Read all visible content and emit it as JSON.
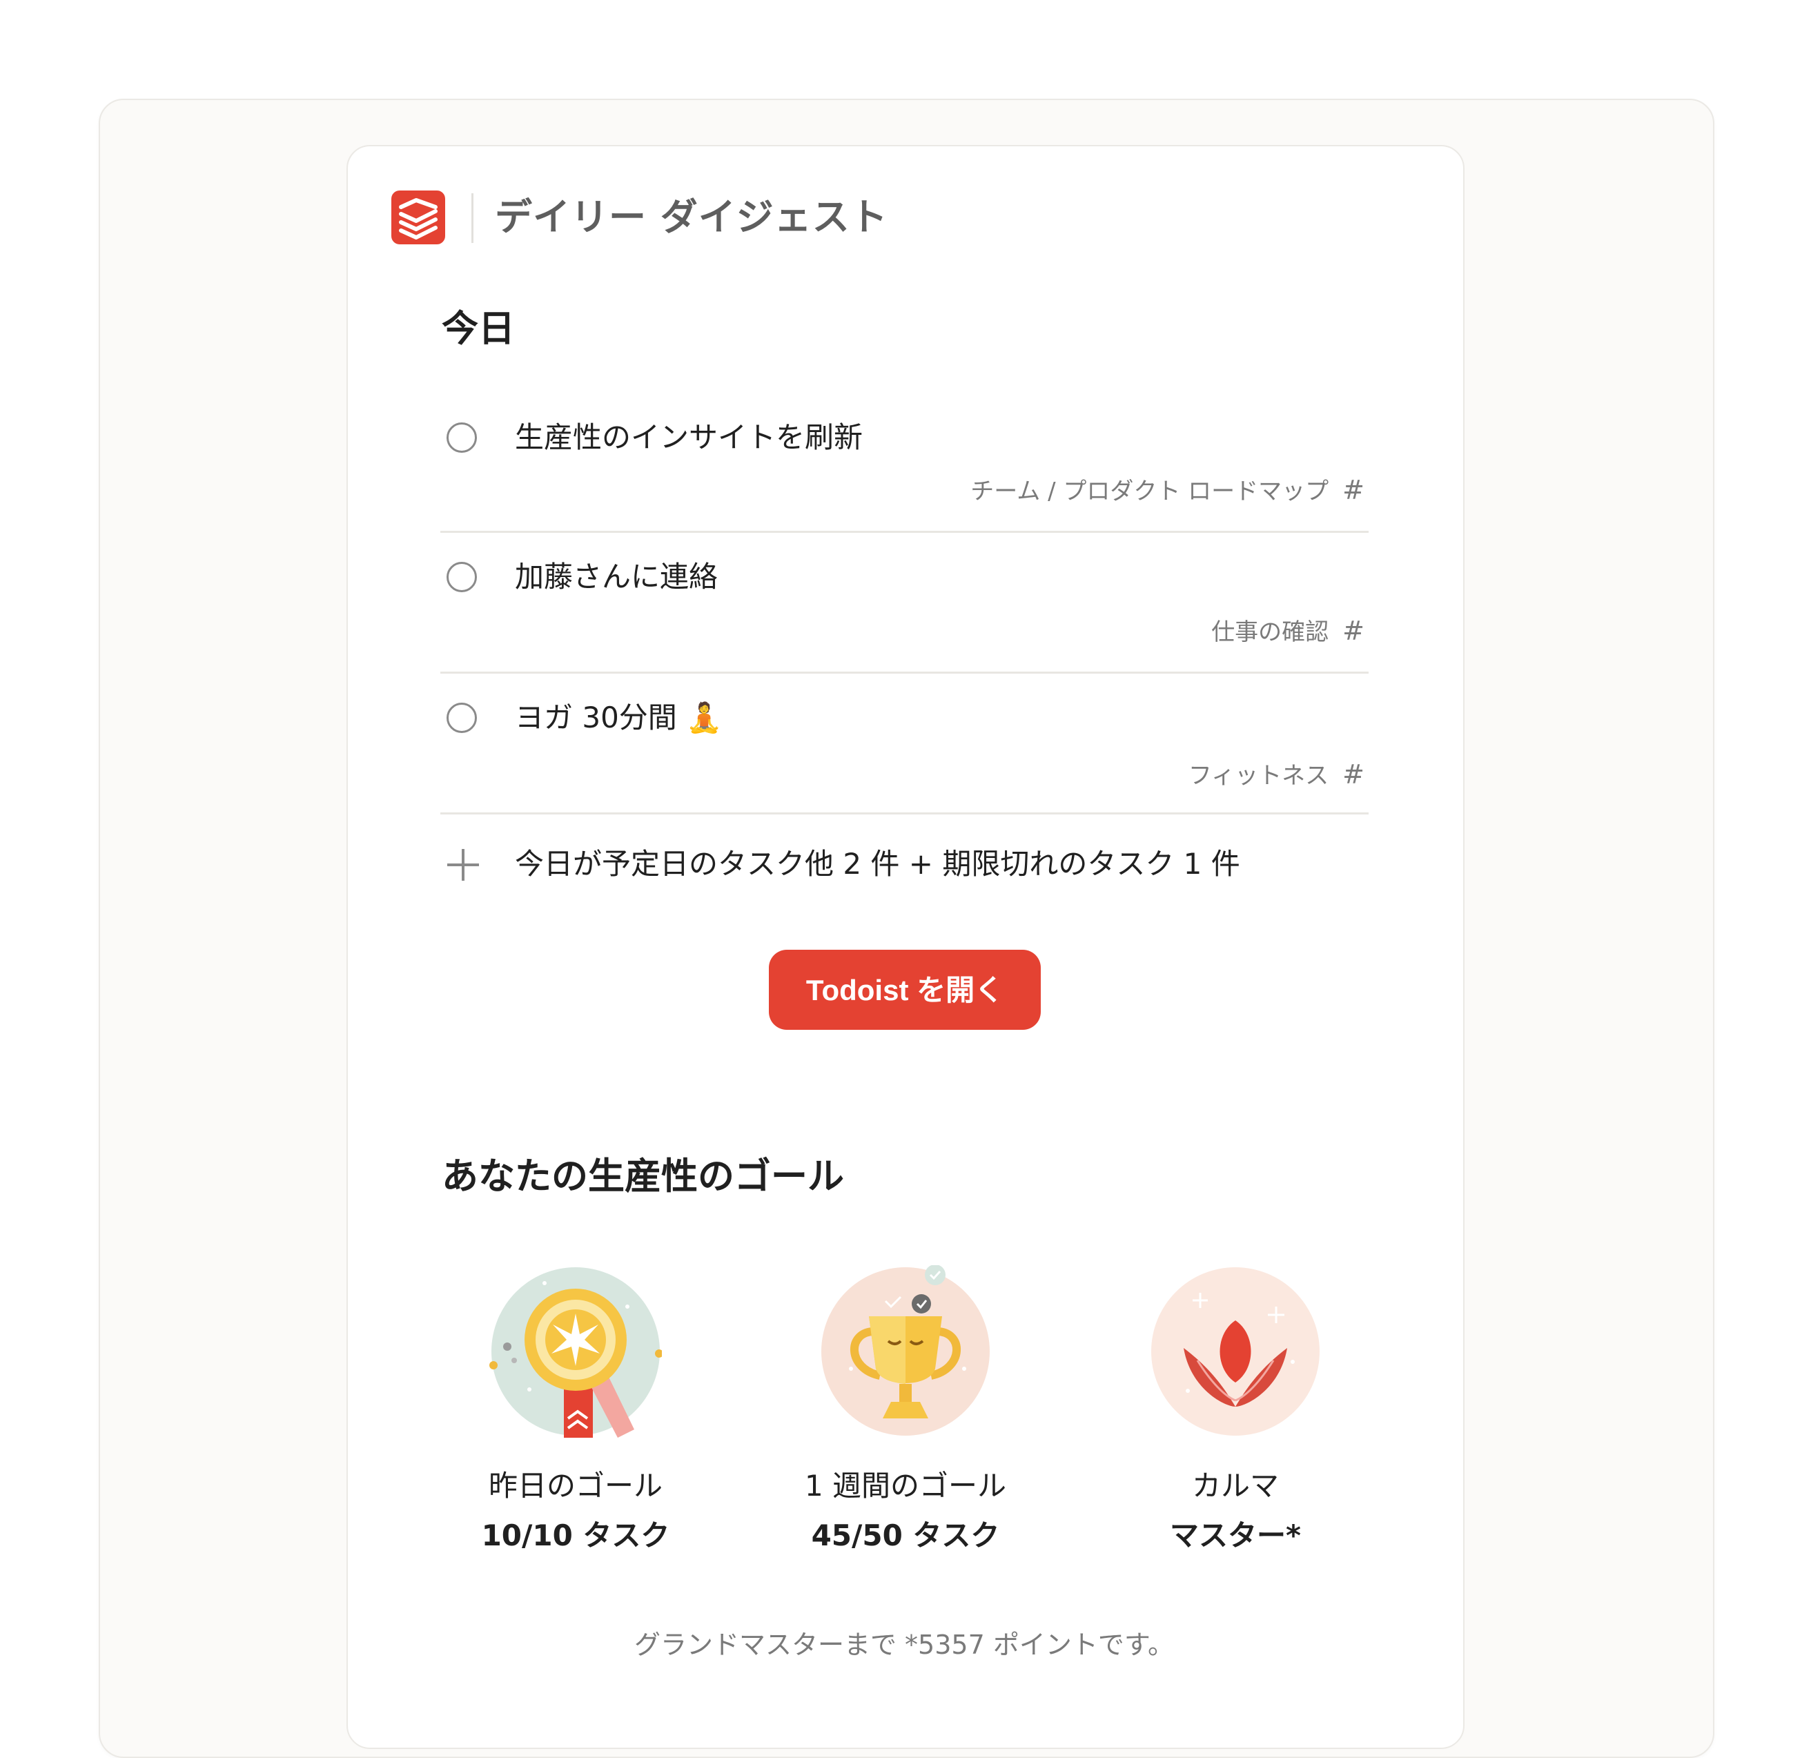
{
  "header": {
    "title": "デイリー ダイジェスト",
    "logo_icon": "todoist-logo-icon",
    "brand_color": "#e44232"
  },
  "today": {
    "heading": "今日",
    "tasks": [
      {
        "name": "生産性のインサイトを刷新",
        "project": "チーム / プロダクト ロードマップ",
        "project_icon": "#"
      },
      {
        "name": "加藤さんに連絡",
        "project": "仕事の確認",
        "project_icon": "#"
      },
      {
        "name": "ヨガ 30分間 🧘",
        "project": "フィットネス",
        "project_icon": "#"
      }
    ],
    "more_text": "今日が予定日のタスク他 2 件 + 期限切れのタスク 1 件"
  },
  "open_button": {
    "label": "Todoist を開く"
  },
  "goals": {
    "heading": "あなたの生産性のゴール",
    "items": [
      {
        "label": "昨日のゴール",
        "value": "10/10 タスク",
        "icon": "ribbon-medal-icon"
      },
      {
        "label": "1 週間のゴール",
        "value": "45/50 タスク",
        "icon": "trophy-icon"
      },
      {
        "label": "カルマ",
        "value": "マスター*",
        "icon": "karma-flower-icon"
      }
    ],
    "footnote": "グランドマスターまで *5357 ポイントです。"
  }
}
